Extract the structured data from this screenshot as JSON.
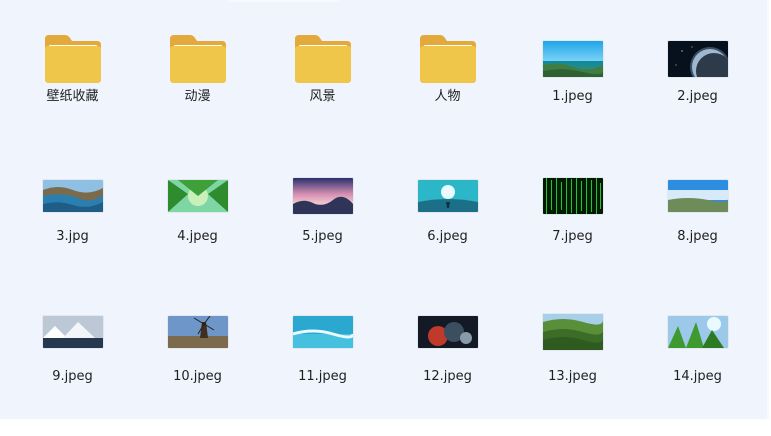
{
  "files": {
    "items": [
      {
        "label": "壁纸收藏",
        "type": "folder",
        "icon": "folder-icon"
      },
      {
        "label": "动漫",
        "type": "folder",
        "icon": "folder-icon"
      },
      {
        "label": "风景",
        "type": "folder",
        "icon": "folder-icon"
      },
      {
        "label": "人物",
        "type": "folder",
        "icon": "folder-icon"
      },
      {
        "label": "1.jpeg",
        "type": "image",
        "icon": "image-icon"
      },
      {
        "label": "2.jpeg",
        "type": "image",
        "icon": "image-icon"
      },
      {
        "label": "3.jpg",
        "type": "image",
        "icon": "image-icon"
      },
      {
        "label": "4.jpeg",
        "type": "image",
        "icon": "image-icon"
      },
      {
        "label": "5.jpeg",
        "type": "image",
        "icon": "image-icon"
      },
      {
        "label": "6.jpeg",
        "type": "image",
        "icon": "image-icon"
      },
      {
        "label": "7.jpeg",
        "type": "image",
        "icon": "image-icon"
      },
      {
        "label": "8.jpeg",
        "type": "image",
        "icon": "image-icon"
      },
      {
        "label": "9.jpeg",
        "type": "image",
        "icon": "image-icon"
      },
      {
        "label": "10.jpeg",
        "type": "image",
        "icon": "image-icon"
      },
      {
        "label": "11.jpeg",
        "type": "image",
        "icon": "image-icon"
      },
      {
        "label": "12.jpeg",
        "type": "image",
        "icon": "image-icon"
      },
      {
        "label": "13.jpeg",
        "type": "image",
        "icon": "image-icon"
      },
      {
        "label": "14.jpeg",
        "type": "image",
        "icon": "image-icon"
      }
    ]
  },
  "colors": {
    "background": "#eff4fd",
    "folder_front": "#f0c64a",
    "folder_back": "#e3a93a",
    "text": "#1f1f1f"
  }
}
